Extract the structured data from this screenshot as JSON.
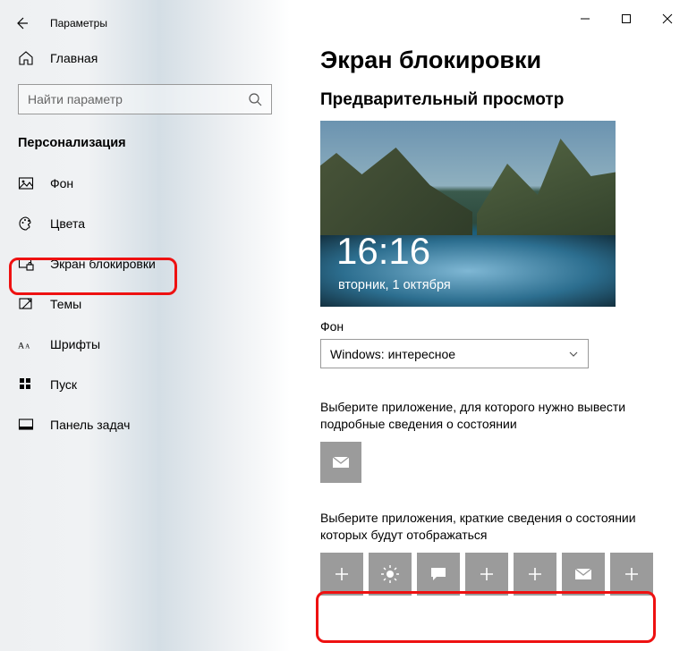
{
  "window": {
    "title": "Параметры"
  },
  "sidebar": {
    "home": "Главная",
    "search_placeholder": "Найти параметр",
    "section": "Персонализация",
    "items": [
      {
        "label": "Фон"
      },
      {
        "label": "Цвета"
      },
      {
        "label": "Экран блокировки"
      },
      {
        "label": "Темы"
      },
      {
        "label": "Шрифты"
      },
      {
        "label": "Пуск"
      },
      {
        "label": "Панель задач"
      }
    ]
  },
  "main": {
    "title": "Экран блокировки",
    "preview_label": "Предварительный просмотр",
    "clock_time": "16:16",
    "clock_date": "вторник, 1 октября",
    "bg_label": "Фон",
    "bg_value": "Windows: интересное",
    "detailed_label": "Выберите приложение, для которого нужно вывести подробные сведения о состоянии",
    "quick_label": "Выберите приложения, краткие сведения о состоянии которых будут отображаться",
    "quick_tiles": [
      "plus",
      "weather",
      "chat",
      "plus",
      "plus",
      "mail",
      "plus"
    ]
  }
}
